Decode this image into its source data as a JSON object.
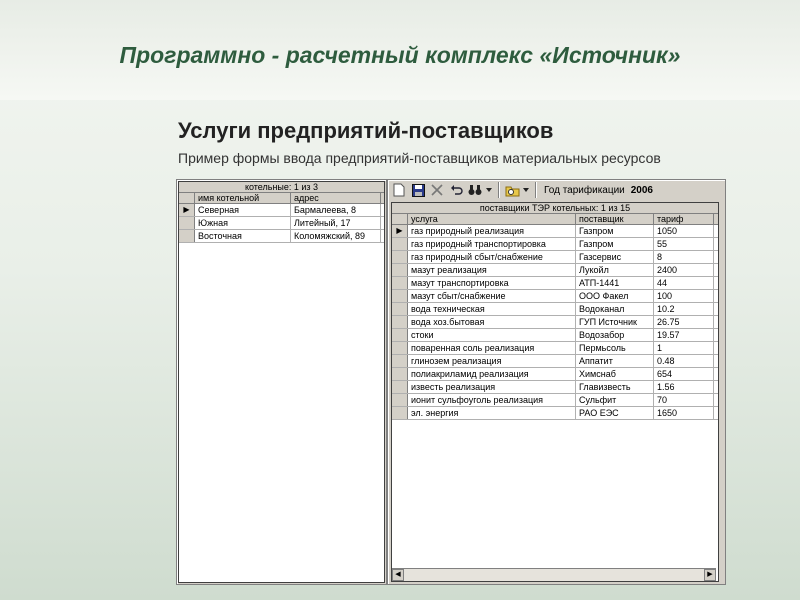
{
  "header": {
    "title": "Программно - расчетный комплекс «Источник»",
    "subtitle": "Услуги предприятий-поставщиков",
    "caption": "Пример формы ввода предприятий-поставщиков материальных ресурсов"
  },
  "boilers": {
    "title": "котельные: 1 из 3",
    "columns": [
      "имя котельной",
      "адрес"
    ],
    "rows": [
      {
        "name": "Северная",
        "address": "Бармалеева, 8"
      },
      {
        "name": "Южная",
        "address": "Литейный, 17"
      },
      {
        "name": "Восточная",
        "address": "Коломяжский, 89"
      }
    ],
    "current_marker": "▶"
  },
  "toolbar": {
    "year_label": "Год тарификации",
    "year_value": "2006",
    "icons": [
      "new-icon",
      "save-icon",
      "delete-icon",
      "undo-icon",
      "binoculars-icon",
      "dropdown-icon",
      "folder-search-icon",
      "dropdown-icon"
    ]
  },
  "suppliers": {
    "title": "поставщики ТЭР котельных: 1 из 15",
    "columns": [
      "услуга",
      "поставщик",
      "тариф"
    ],
    "rows": [
      {
        "service": "газ природный реализация",
        "supplier": "Газпром",
        "tariff": "1050"
      },
      {
        "service": "газ природный транспортировка",
        "supplier": "Газпром",
        "tariff": "55"
      },
      {
        "service": "газ природный сбыт/снабжение",
        "supplier": "Газсервис",
        "tariff": "8"
      },
      {
        "service": "мазут реализация",
        "supplier": "Лукойл",
        "tariff": "2400"
      },
      {
        "service": "мазут транспортировка",
        "supplier": "АТП-1441",
        "tariff": "44"
      },
      {
        "service": "мазут сбыт/снабжение",
        "supplier": "ООО Факел",
        "tariff": "100"
      },
      {
        "service": "вода техническая",
        "supplier": "Водоканал",
        "tariff": "10.2"
      },
      {
        "service": "вода хоз.бытовая",
        "supplier": "ГУП Источник",
        "tariff": "26.75"
      },
      {
        "service": "стоки",
        "supplier": "Водозабор",
        "tariff": "19.57"
      },
      {
        "service": "поваренная соль реализация",
        "supplier": "Пермьсоль",
        "tariff": "1"
      },
      {
        "service": "глинозем реализация",
        "supplier": "Аппатит",
        "tariff": "0.48"
      },
      {
        "service": "полиакриламид реализация",
        "supplier": "Химснаб",
        "tariff": "654"
      },
      {
        "service": "известь реализация",
        "supplier": "Главизвесть",
        "tariff": "1.56"
      },
      {
        "service": "ионит сульфоуголь реализация",
        "supplier": "Сульфит",
        "tariff": "70"
      },
      {
        "service": "эл. энергия",
        "supplier": "РАО ЕЭС",
        "tariff": "1650"
      }
    ],
    "current_marker": "▶"
  }
}
